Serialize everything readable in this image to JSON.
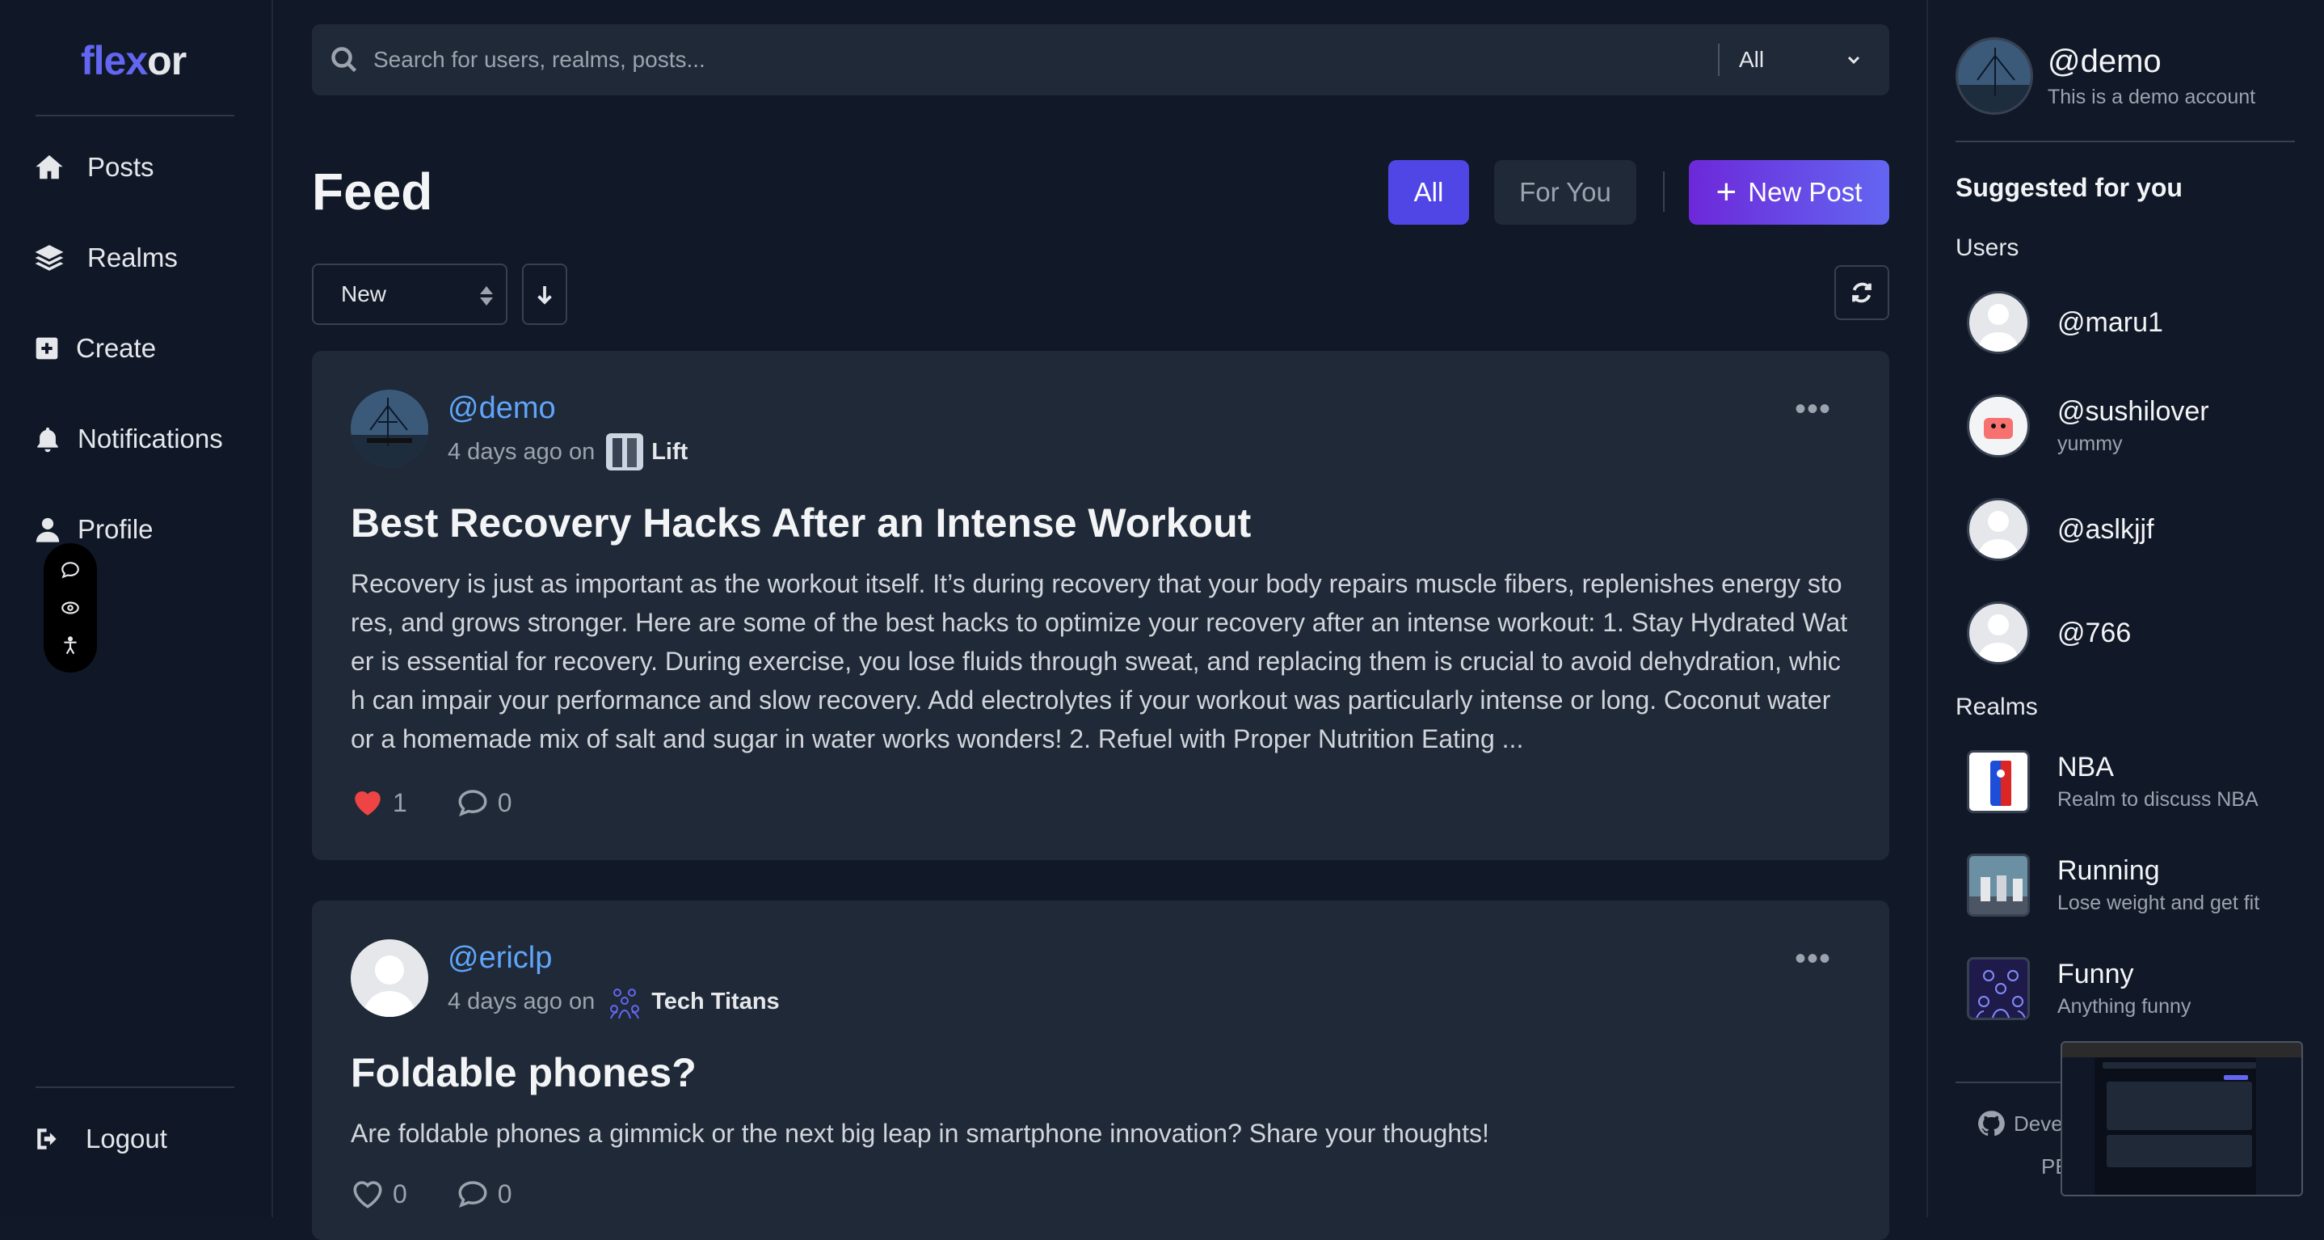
{
  "brand": {
    "part1": "flex",
    "part2": "or"
  },
  "nav": {
    "items": [
      {
        "label": "Posts",
        "icon": "home-icon"
      },
      {
        "label": "Realms",
        "icon": "layers-icon"
      },
      {
        "label": "Create",
        "icon": "plus-square-icon"
      },
      {
        "label": "Notifications",
        "icon": "bell-icon"
      },
      {
        "label": "Profile",
        "icon": "user-icon"
      }
    ],
    "logout": "Logout"
  },
  "search": {
    "placeholder": "Search for users, realms, posts...",
    "scope": "All"
  },
  "feed": {
    "title": "Feed",
    "filter_all": "All",
    "filter_for_you": "For You",
    "new_post": "New Post",
    "sort": "New"
  },
  "posts": [
    {
      "username": "@demo",
      "time": "4 days ago on",
      "realm": "Lift",
      "title": "Best Recovery Hacks After an Intense Workout",
      "body": "Recovery is just as important as the workout itself. It’s during recovery that your body repairs muscle fibers, replenishes energy stores, and grows stronger. Here are some of the best hacks to optimize your recovery after an intense workout: 1. Stay Hydrated Water is essential for recovery. During exercise, you lose fluids through sweat, and replacing them is crucial to avoid dehydration, which can impair your performance and slow recovery. Add electrolytes if your workout was particularly intense or long. Coconut water or a homemade mix of salt and sugar in water works wonders! 2. Refuel with Proper Nutrition Eating ...",
      "likes": "1",
      "comments": "0",
      "liked": true
    },
    {
      "username": "@ericlp",
      "time": "4 days ago on",
      "realm": "Tech Titans",
      "title": "Foldable phones?",
      "body": "Are foldable phones a gimmick or the next big leap in smartphone innovation? Share your thoughts!",
      "likes": "0",
      "comments": "0",
      "liked": false
    }
  ],
  "profile": {
    "username": "@demo",
    "bio": "This is a demo account"
  },
  "suggested": {
    "title": "Suggested for you",
    "users_label": "Users",
    "users": [
      {
        "name": "@maru1",
        "sub": ""
      },
      {
        "name": "@sushilover",
        "sub": "yummy"
      },
      {
        "name": "@aslkjjf",
        "sub": ""
      },
      {
        "name": "@766",
        "sub": ""
      }
    ],
    "realms_label": "Realms",
    "realms": [
      {
        "name": "NBA",
        "sub": "Realm to discuss NBA"
      },
      {
        "name": "Running",
        "sub": "Lose weight and get fit"
      },
      {
        "name": "Funny",
        "sub": "Anything funny"
      }
    ]
  },
  "footer": {
    "dev": "Deve",
    "line2": "PE"
  },
  "colors": {
    "accent": "#4f46e5",
    "link": "#60a5fa",
    "heart": "#ef4444",
    "bg": "#111827",
    "card": "#1f2937"
  }
}
